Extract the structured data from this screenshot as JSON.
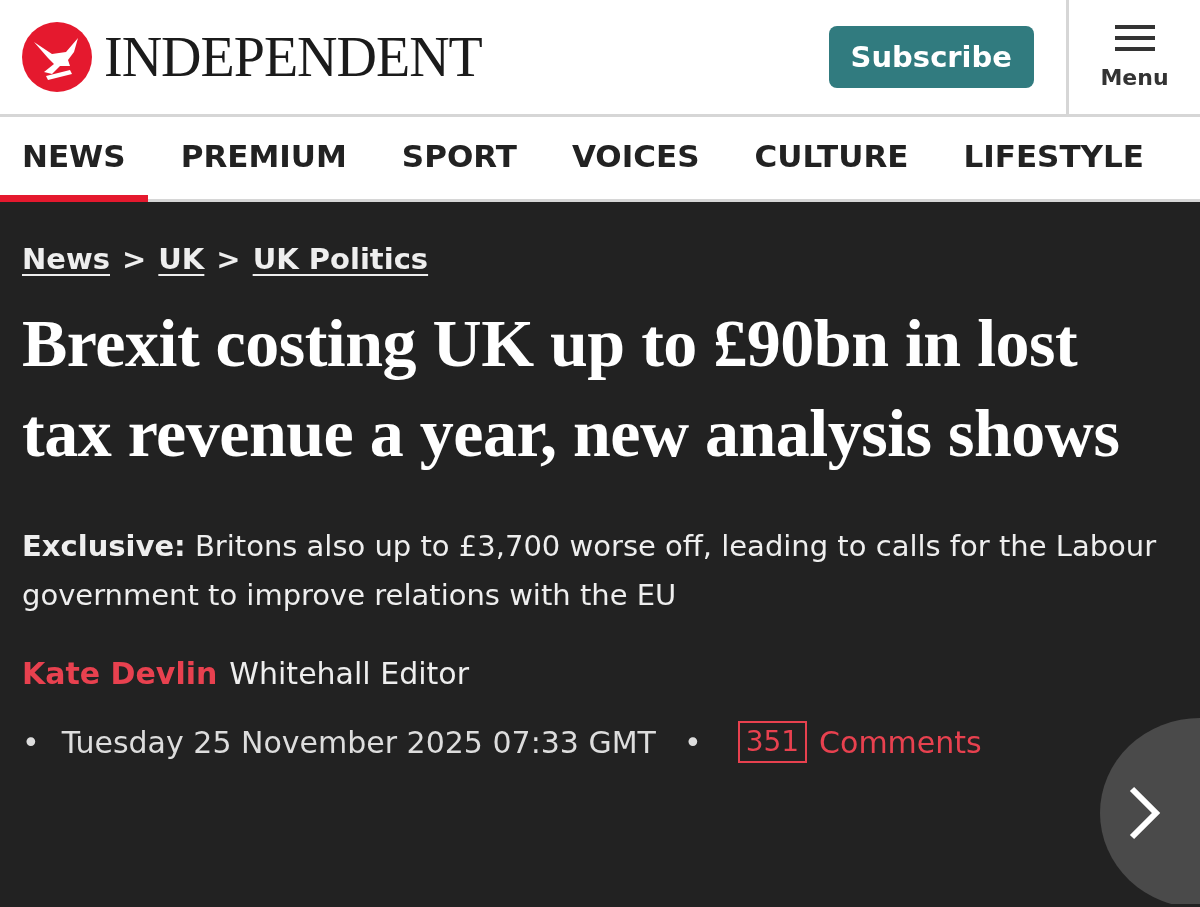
{
  "header": {
    "logo_text": "INDEPENDENT",
    "subscribe": "Subscribe",
    "menu": "Menu"
  },
  "nav": [
    {
      "label": "NEWS",
      "selected": true
    },
    {
      "label": "PREMIUM",
      "selected": false
    },
    {
      "label": "SPORT",
      "selected": false
    },
    {
      "label": "VOICES",
      "selected": false
    },
    {
      "label": "CULTURE",
      "selected": false
    },
    {
      "label": "LIFESTYLE",
      "selected": false
    }
  ],
  "breadcrumb": {
    "items": [
      "News",
      "UK",
      "UK Politics"
    ],
    "separator": ">"
  },
  "headline": "Brexit costing UK up to £90bn in lost tax revenue a year, new analysis shows",
  "standfirst": "**Exclusive:** Britons also up to £3,700 worse off, leading to calls for the Labour government to improve relations with the EU",
  "byline": {
    "author": "Kate Devlin",
    "role": "Whitehall Editor"
  },
  "meta": {
    "bullet": "•",
    "date": "Tuesday 25 November 2025 07:33 GMT",
    "comment_count": "351",
    "comments_label": "Comments"
  }
}
